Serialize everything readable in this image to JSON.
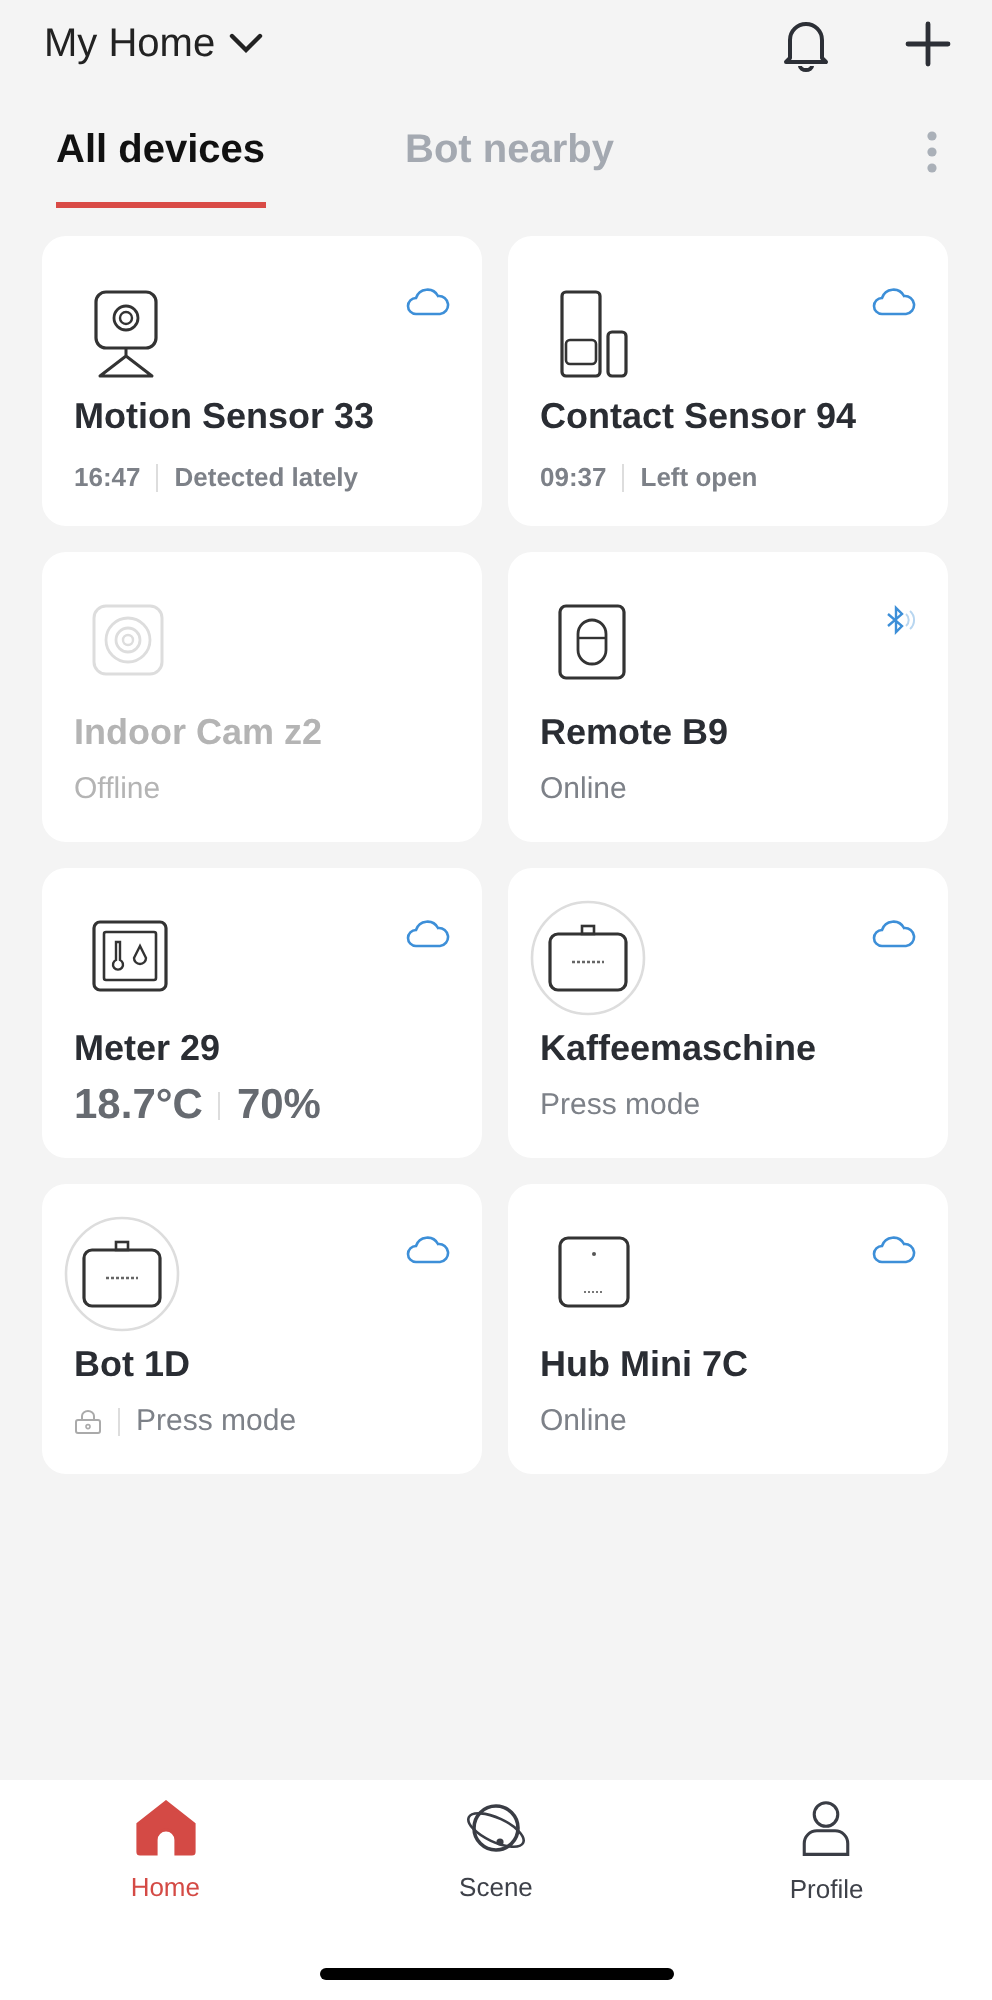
{
  "header": {
    "home_name": "My Home"
  },
  "tabs": [
    {
      "label": "All devices",
      "selected": true
    },
    {
      "label": "Bot nearby",
      "selected": false
    }
  ],
  "devices": [
    {
      "name": "Motion Sensor 33",
      "kind": "camera",
      "online": true,
      "link": {
        "kind": "cloud"
      },
      "status": {
        "kind": "event",
        "time": "16:47",
        "text": "Detected lately"
      }
    },
    {
      "name": "Contact Sensor 94",
      "kind": "contact",
      "online": true,
      "link": {
        "kind": "cloud"
      },
      "status": {
        "kind": "event",
        "time": "09:37",
        "text": "Left open"
      }
    },
    {
      "name": "Indoor Cam z2",
      "kind": "lens",
      "online": false,
      "status": {
        "kind": "plain",
        "text": "Offline"
      }
    },
    {
      "name": "Remote B9",
      "kind": "remote",
      "online": true,
      "link": {
        "kind": "bluetooth"
      },
      "status": {
        "kind": "plain",
        "text": "Online"
      }
    },
    {
      "name": "Meter 29",
      "kind": "meter",
      "online": true,
      "link": {
        "kind": "cloud"
      },
      "status": {
        "kind": "reading",
        "values": [
          "18.7°C",
          "70%"
        ]
      }
    },
    {
      "name": "Kaffeemaschine",
      "kind": "bot",
      "online": true,
      "link": {
        "kind": "cloud"
      },
      "status": {
        "kind": "plain",
        "text": "Press mode"
      }
    },
    {
      "name": "Bot 1D",
      "kind": "bot",
      "online": true,
      "link": {
        "kind": "cloud"
      },
      "status": {
        "kind": "locked",
        "text": "Press mode"
      }
    },
    {
      "name": "Hub Mini 7C",
      "kind": "hub",
      "online": true,
      "link": {
        "kind": "cloud"
      },
      "status": {
        "kind": "plain",
        "text": "Online"
      }
    }
  ],
  "nav": [
    {
      "label": "Home",
      "kind": "home",
      "selected": true
    },
    {
      "label": "Scene",
      "kind": "scene",
      "selected": false
    },
    {
      "label": "Profile",
      "kind": "profile",
      "selected": false
    }
  ]
}
